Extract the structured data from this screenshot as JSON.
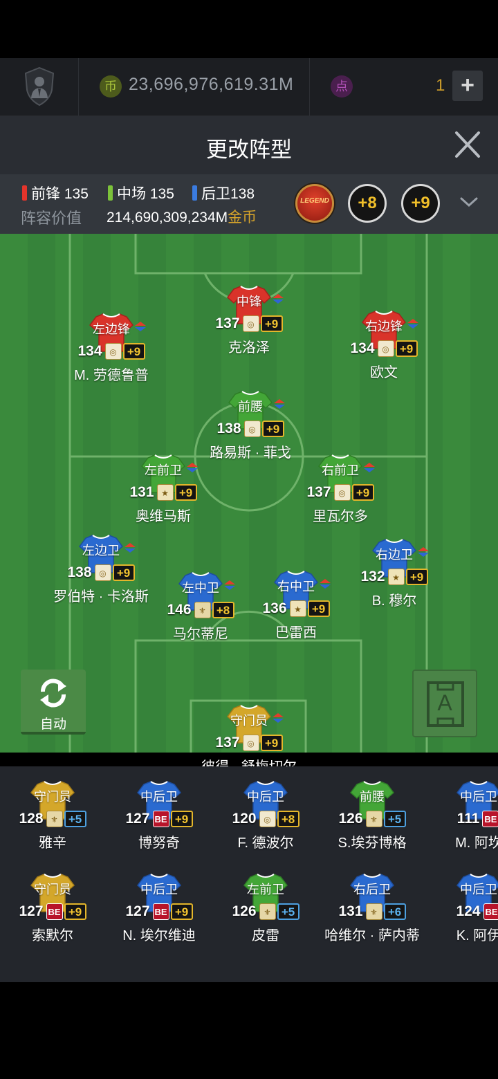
{
  "currency": {
    "coin_icon": "币",
    "coin_value": "23,696,976,619.31M",
    "point_icon": "点",
    "point_value": "1",
    "add_label": "+"
  },
  "header": {
    "title": "更改阵型"
  },
  "stats": {
    "fw_label": "前锋",
    "fw_value": "135",
    "mf_label": "中场",
    "mf_value": "135",
    "df_label": "后卫",
    "df_value": "138",
    "team_value_label": "阵容价值",
    "team_value": "214,690,309,234M",
    "team_value_unit": "金币",
    "legend_badge": "LEGEND",
    "badge_a": "+8",
    "badge_b": "+9",
    "colors": {
      "fw": "#e4342b",
      "mf": "#7cc23a",
      "df": "#3a7be0",
      "gold": "#d8a52a"
    }
  },
  "lineup": [
    {
      "pos": "中锋",
      "rating": "137",
      "season": "gold",
      "season_icon": "◎",
      "enh": "+9",
      "enh_color": "gold",
      "name": "克洛泽",
      "shirt": "red"
    },
    {
      "pos": "左边锋",
      "rating": "134",
      "season": "gold",
      "season_icon": "◎",
      "enh": "+9",
      "enh_color": "gold",
      "name": "M. 劳德鲁普",
      "shirt": "red"
    },
    {
      "pos": "右边锋",
      "rating": "134",
      "season": "gold",
      "season_icon": "◎",
      "enh": "+9",
      "enh_color": "gold",
      "name": "欧文",
      "shirt": "red"
    },
    {
      "pos": "前腰",
      "rating": "138",
      "season": "gold",
      "season_icon": "◎",
      "enh": "+9",
      "enh_color": "gold",
      "name": "路易斯 · 菲戈",
      "shirt": "green"
    },
    {
      "pos": "左前卫",
      "rating": "131",
      "season": "star",
      "season_icon": "★",
      "enh": "+9",
      "enh_color": "gold",
      "name": "奥维马斯",
      "shirt": "green"
    },
    {
      "pos": "右前卫",
      "rating": "137",
      "season": "gold",
      "season_icon": "◎",
      "enh": "+9",
      "enh_color": "gold",
      "name": "里瓦尔多",
      "shirt": "green"
    },
    {
      "pos": "左边卫",
      "rating": "138",
      "season": "gold",
      "season_icon": "◎",
      "enh": "+9",
      "enh_color": "gold",
      "name": "罗伯特 · 卡洛斯",
      "shirt": "blue"
    },
    {
      "pos": "右边卫",
      "rating": "132",
      "season": "star",
      "season_icon": "★",
      "enh": "+9",
      "enh_color": "gold",
      "name": "B. 穆尔",
      "shirt": "blue"
    },
    {
      "pos": "左中卫",
      "rating": "146",
      "season": "fleur",
      "season_icon": "⚜",
      "enh": "+8",
      "enh_color": "gold",
      "name": "马尔蒂尼",
      "shirt": "blue"
    },
    {
      "pos": "右中卫",
      "rating": "136",
      "season": "star",
      "season_icon": "★",
      "enh": "+9",
      "enh_color": "gold",
      "name": "巴雷西",
      "shirt": "blue"
    },
    {
      "pos": "守门员",
      "rating": "137",
      "season": "gold",
      "season_icon": "◎",
      "enh": "+9",
      "enh_color": "gold",
      "name": "彼得 · 舒梅切尔",
      "shirt": "yellow"
    }
  ],
  "controls": {
    "auto_label": "自动",
    "tactics_label": "A"
  },
  "bench": [
    {
      "pos": "守门员",
      "rating": "128",
      "season": "fleur",
      "season_icon": "⚜",
      "enh": "+5",
      "enh_color": "blue",
      "name": "雅辛",
      "shirt": "yellow"
    },
    {
      "pos": "中后卫",
      "rating": "127",
      "season": "be",
      "season_icon": "BE",
      "enh": "+9",
      "enh_color": "gold",
      "name": "博努奇",
      "shirt": "blue"
    },
    {
      "pos": "中后卫",
      "rating": "120",
      "season": "gold",
      "season_icon": "◎",
      "enh": "+8",
      "enh_color": "gold",
      "name": "F. 德波尔",
      "shirt": "blue"
    },
    {
      "pos": "前腰",
      "rating": "126",
      "season": "fleur",
      "season_icon": "⚜",
      "enh": "+5",
      "enh_color": "blue",
      "name": "S.埃芬博格",
      "shirt": "green"
    },
    {
      "pos": "中后卫",
      "rating": "111",
      "season": "be",
      "season_icon": "BE",
      "enh": "",
      "enh_color": "gold",
      "name": "M. 阿坎",
      "shirt": "blue"
    },
    {
      "pos": "守门员",
      "rating": "127",
      "season": "be",
      "season_icon": "BE",
      "enh": "+9",
      "enh_color": "gold",
      "name": "索默尔",
      "shirt": "yellow"
    },
    {
      "pos": "中后卫",
      "rating": "127",
      "season": "be",
      "season_icon": "BE",
      "enh": "+9",
      "enh_color": "gold",
      "name": "N. 埃尔维迪",
      "shirt": "blue"
    },
    {
      "pos": "左前卫",
      "rating": "126",
      "season": "fleur",
      "season_icon": "⚜",
      "enh": "+5",
      "enh_color": "blue",
      "name": "皮雷",
      "shirt": "green"
    },
    {
      "pos": "右后卫",
      "rating": "131",
      "season": "fleur",
      "season_icon": "⚜",
      "enh": "+6",
      "enh_color": "blue",
      "name": "哈维尔 · 萨内蒂",
      "shirt": "blue"
    },
    {
      "pos": "中后卫",
      "rating": "124",
      "season": "be",
      "season_icon": "BE",
      "enh": "",
      "enh_color": "gold",
      "name": "K. 阿伊",
      "shirt": "blue"
    }
  ]
}
